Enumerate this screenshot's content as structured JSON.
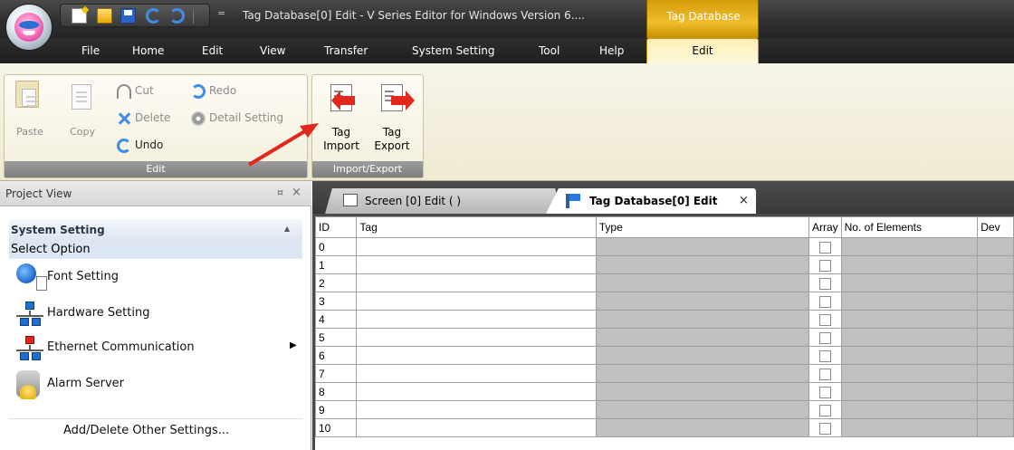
{
  "window": {
    "title": "Tag Database[0] Edit  - V Series Editor for Windows Version 6....",
    "qat_more": "="
  },
  "context_tab": {
    "header": "Tag Database",
    "tab": "Edit"
  },
  "ribbon_tabs": [
    "File",
    "Home",
    "Edit",
    "View",
    "Transfer",
    "System Setting",
    "Tool",
    "Help"
  ],
  "ribbon": {
    "edit_group": {
      "label": "Edit",
      "paste": "Paste",
      "copy": "Copy",
      "cut": "Cut",
      "delete": "Delete",
      "undo": "Undo",
      "redo": "Redo",
      "detail_setting": "Detail Setting"
    },
    "io_group": {
      "label": "Import/Export",
      "import_line1": "Tag",
      "import_line2": "Import",
      "export_line1": "Tag",
      "export_line2": "Export"
    }
  },
  "project_view": {
    "title": "Project View",
    "pin": "¤",
    "close": "×",
    "section_header": "System Setting",
    "select_option": "Select Option",
    "items": [
      "Font Setting",
      "Hardware Setting",
      "Ethernet Communication",
      "Alarm Server"
    ],
    "submenu_arrow": "▶",
    "add_delete": "Add/Delete Other Settings..."
  },
  "doc_tabs": {
    "screen_tab": "Screen [0] Edit (          )",
    "tag_tab": "Tag Database[0] Edit",
    "close": "×"
  },
  "grid": {
    "columns": [
      "ID",
      "Tag",
      "Type",
      "Array",
      "No. of Elements",
      "Dev"
    ],
    "rows": [
      "0",
      "1",
      "2",
      "3",
      "4",
      "5",
      "6",
      "7",
      "8",
      "9",
      "10"
    ]
  },
  "colors": {
    "context_accent": "#f0bd2c",
    "annotation_arrow": "#e2271b"
  }
}
